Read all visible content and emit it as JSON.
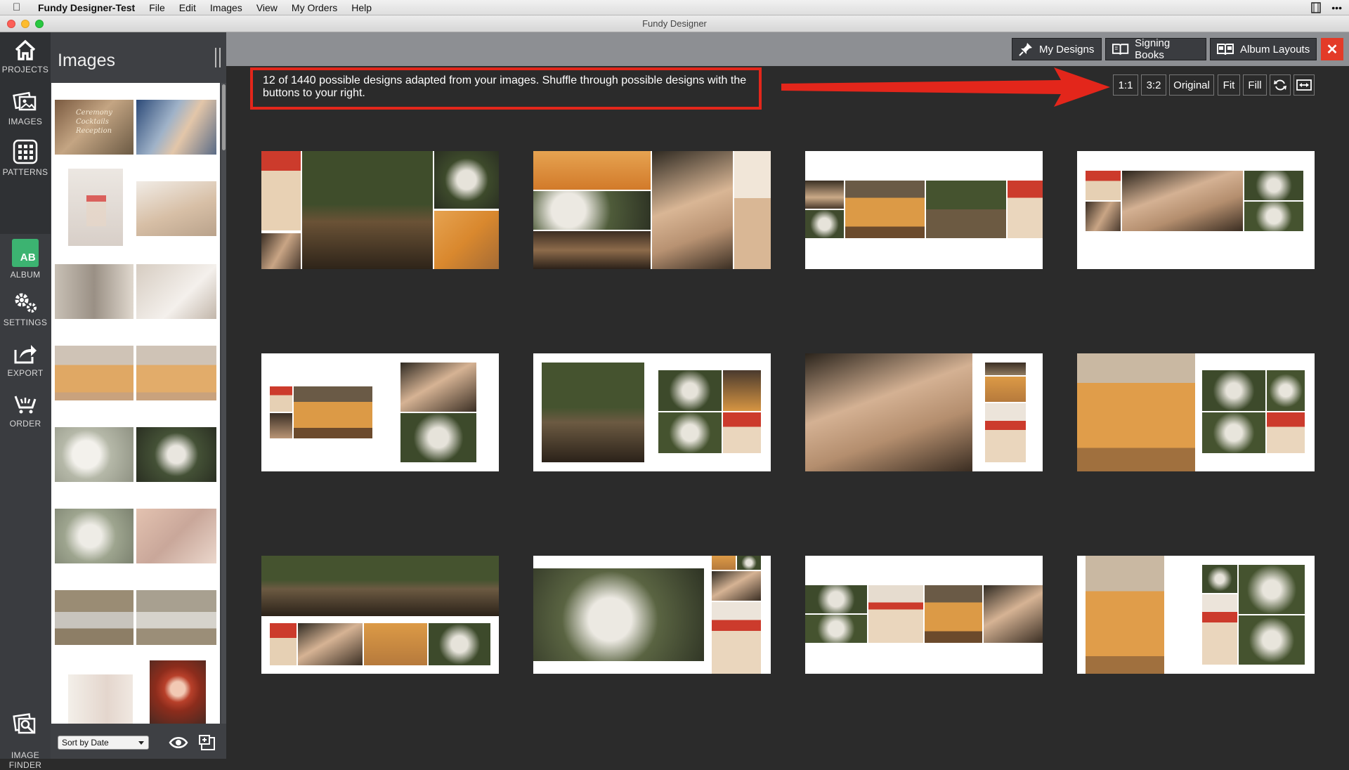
{
  "menubar": {
    "app_name": "Fundy Designer-Test",
    "items": [
      "File",
      "Edit",
      "Images",
      "View",
      "My Orders",
      "Help"
    ]
  },
  "window": {
    "title": "Fundy Designer"
  },
  "rail": {
    "items": [
      {
        "label": "PROJECTS",
        "icon": "home-icon"
      },
      {
        "label": "IMAGES",
        "icon": "images-icon"
      },
      {
        "label": "PATTERNS",
        "icon": "grid-icon"
      },
      {
        "label": "ALBUM",
        "icon": "album-ab-icon",
        "badge": "AB"
      },
      {
        "label": "SETTINGS",
        "icon": "gears-icon"
      },
      {
        "label": "EXPORT",
        "icon": "share-icon"
      },
      {
        "label": "ORDER",
        "icon": "cart-icon"
      },
      {
        "label": "IMAGE\nFINDER",
        "icon": "image-finder-icon"
      }
    ]
  },
  "images_panel": {
    "title": "Images",
    "sort_value": "Sort by Date",
    "thumb_text": "Ceremony Cocktails Reception"
  },
  "topbar": {
    "my_designs": "My Designs",
    "signing_books": "Signing Books",
    "album_layouts": "Album Layouts",
    "close": "✕"
  },
  "info": {
    "text": "12 of 1440 possible designs adapted from your images. Shuffle through possible designs with the buttons to your right."
  },
  "controls": {
    "ratio_1_1": "1:1",
    "ratio_3_2": "3:2",
    "original": "Original",
    "fit": "Fit",
    "fill": "Fill"
  },
  "colors": {
    "accent_red": "#e3261b",
    "close_red": "#e33b28",
    "album_green": "#3cb371",
    "canvas_bg": "#2b2b2b"
  }
}
